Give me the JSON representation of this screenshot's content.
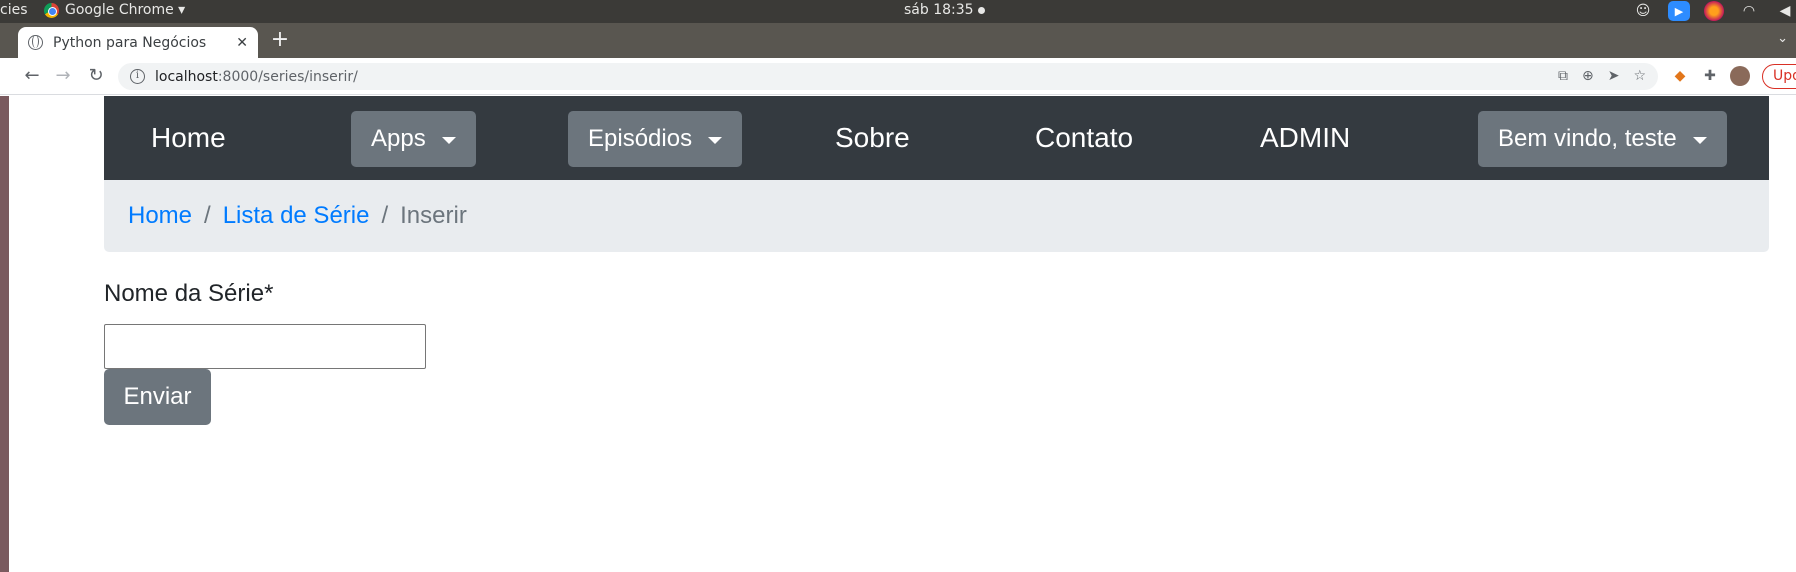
{
  "os": {
    "activities_label": "cies",
    "app_menu_label": "Google Chrome ▾",
    "clock": "sáb 18:35"
  },
  "browser": {
    "tab_title": "Python para Negócios",
    "tab_close": "✕",
    "new_tab": "+",
    "url_host": "localhost",
    "url_path": ":8000/series/inserir/",
    "update_label": "Upd"
  },
  "navbar": {
    "home": "Home",
    "apps": "Apps",
    "episodios": "Episódios",
    "sobre": "Sobre",
    "contato": "Contato",
    "admin": "ADMIN",
    "user_menu": "Bem vindo, teste"
  },
  "breadcrumb": {
    "home": "Home",
    "lista": "Lista de Série",
    "active": "Inserir",
    "separator": "/"
  },
  "form": {
    "label": "Nome da Série*",
    "value": "",
    "submit": "Enviar"
  },
  "colors": {
    "navbar_bg": "#343a40",
    "dropdown_bg": "#6c757d",
    "breadcrumb_bg": "#e9ecef",
    "link": "#007bff"
  }
}
